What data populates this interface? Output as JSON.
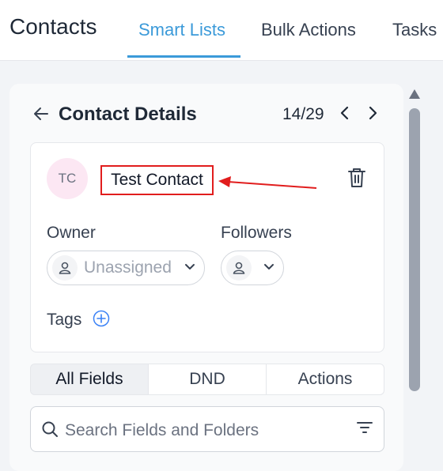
{
  "header": {
    "title": "Contacts",
    "tabs": [
      {
        "label": "Smart Lists",
        "active": true
      },
      {
        "label": "Bulk Actions",
        "active": false
      },
      {
        "label": "Tasks",
        "active": false
      }
    ]
  },
  "detail": {
    "title": "Contact Details",
    "pager": "14/29"
  },
  "contact": {
    "initials": "TC",
    "name": "Test Contact",
    "owner_label": "Owner",
    "owner_value": "Unassigned",
    "followers_label": "Followers",
    "tags_label": "Tags"
  },
  "field_tabs": [
    "All Fields",
    "DND",
    "Actions"
  ],
  "search": {
    "placeholder": "Search Fields and Folders"
  },
  "colors": {
    "accent": "#3b9ad9",
    "annotation": "#e11d1d",
    "avatar_bg": "#fce7f3"
  }
}
